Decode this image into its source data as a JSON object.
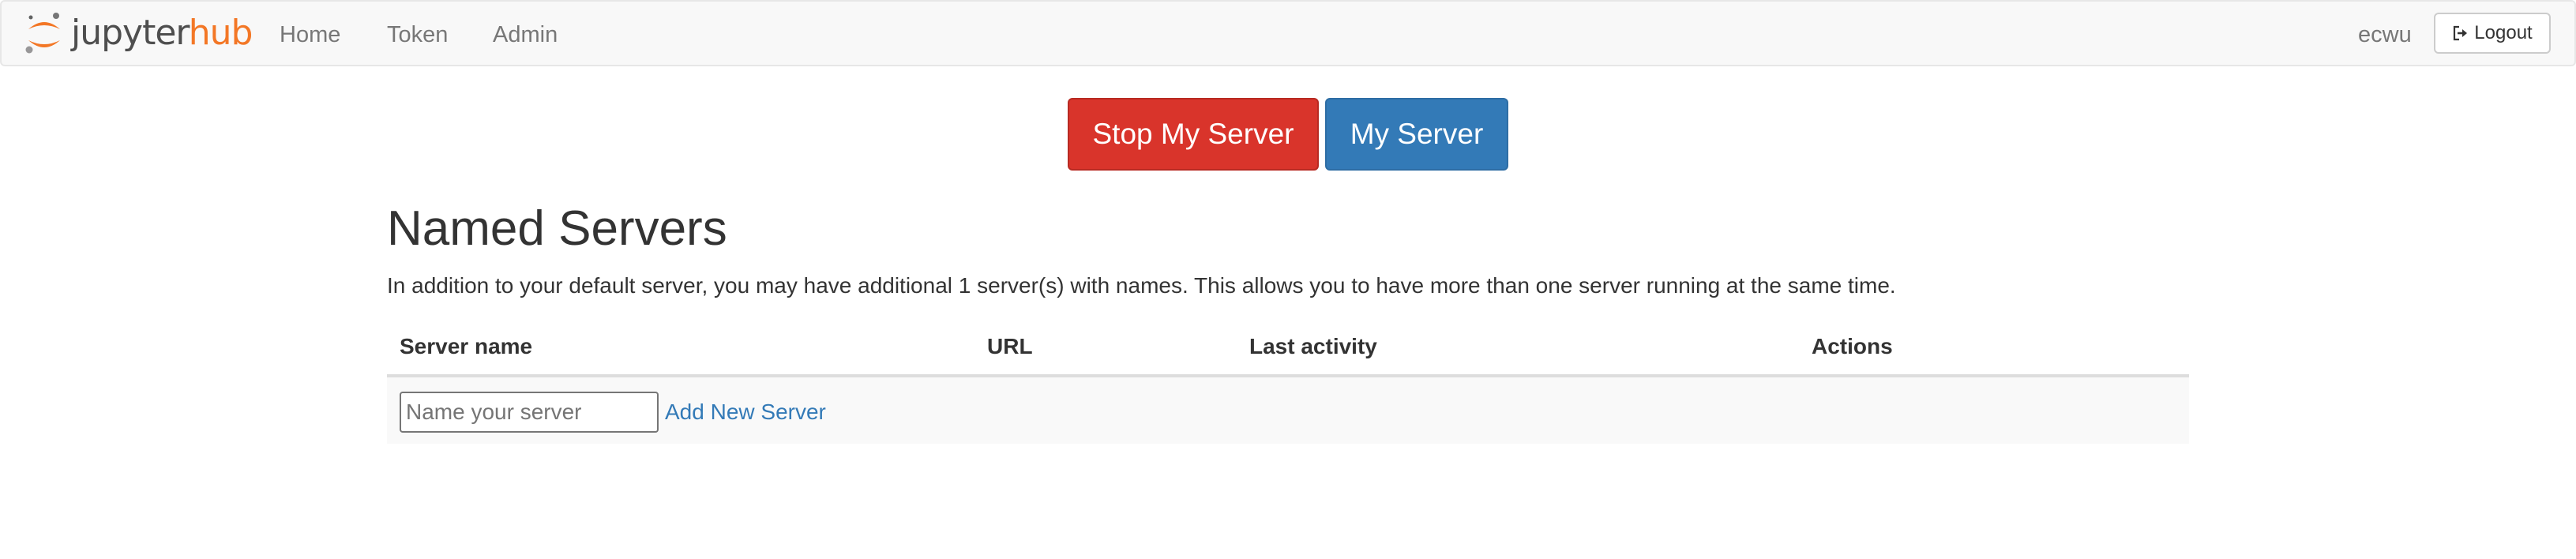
{
  "brand": {
    "part1": "jupyter",
    "part2": "hub",
    "accent_color": "#f37726",
    "logo_icon": "jupyter-logo"
  },
  "nav": {
    "links": [
      "Home",
      "Token",
      "Admin"
    ],
    "user": "ecwu",
    "logout_label": "Logout",
    "logout_icon": "sign-out-icon"
  },
  "actions": {
    "stop_label": "Stop My Server",
    "stop_color": "#d9342b",
    "my_server_label": "My Server",
    "my_server_color": "#337ab7"
  },
  "named_servers": {
    "title": "Named Servers",
    "description": "In addition to your default server, you may have additional 1 server(s) with names. This allows you to have more than one server running at the same time.",
    "columns": [
      "Server name",
      "URL",
      "Last activity",
      "Actions"
    ],
    "new_server": {
      "value": "",
      "placeholder": "Name your server",
      "add_label": "Add New Server",
      "link_color": "#337ab7"
    }
  }
}
